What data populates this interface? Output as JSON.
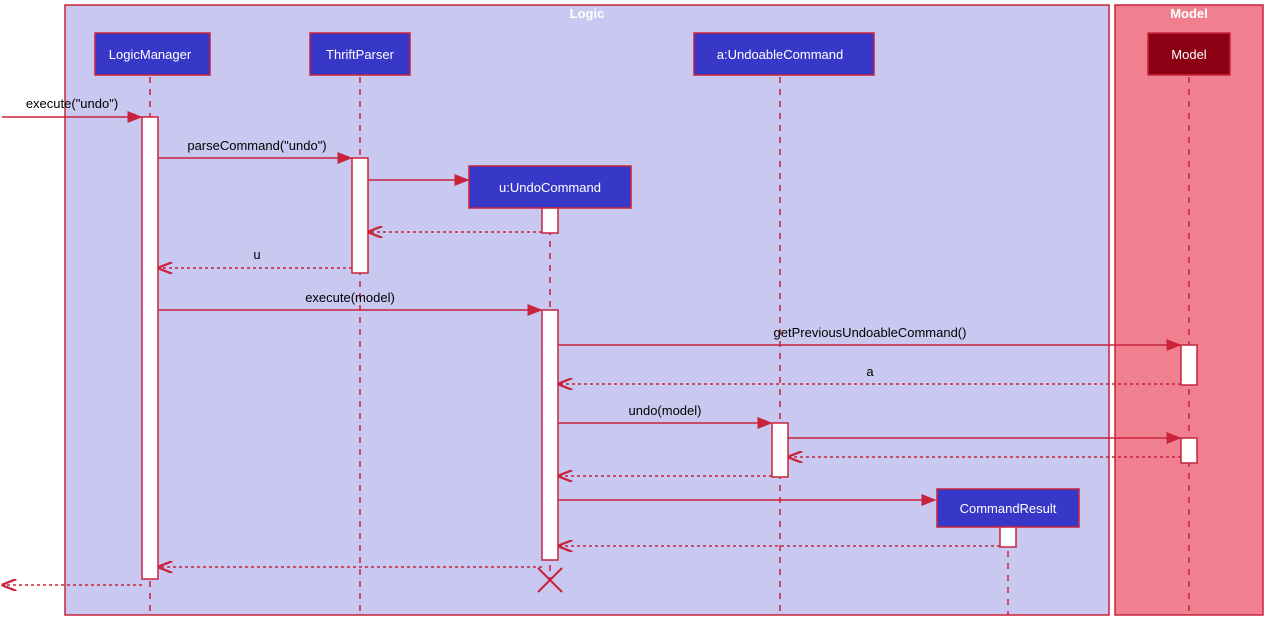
{
  "frames": {
    "logic": "Logic",
    "model": "Model"
  },
  "participants": {
    "logicManager": "LogicManager",
    "thriftParser": "ThriftParser",
    "undoCommand": "u:UndoCommand",
    "undoableCommand": "a:UndoableCommand",
    "model": "Model",
    "commandResult": "CommandResult"
  },
  "messages": {
    "m1": "execute(\"undo\")",
    "m2": "parseCommand(\"undo\")",
    "m3": "u",
    "m4": "execute(model)",
    "m5": "getPreviousUndoableCommand()",
    "m6": "a",
    "m7": "undo(model)"
  },
  "colors": {
    "logicFill": "#c8c8f0",
    "modelFill": "#f08090",
    "boxFill": "#3838c8",
    "modelBoxFill": "#8b0013",
    "stroke": "#c8233b"
  }
}
